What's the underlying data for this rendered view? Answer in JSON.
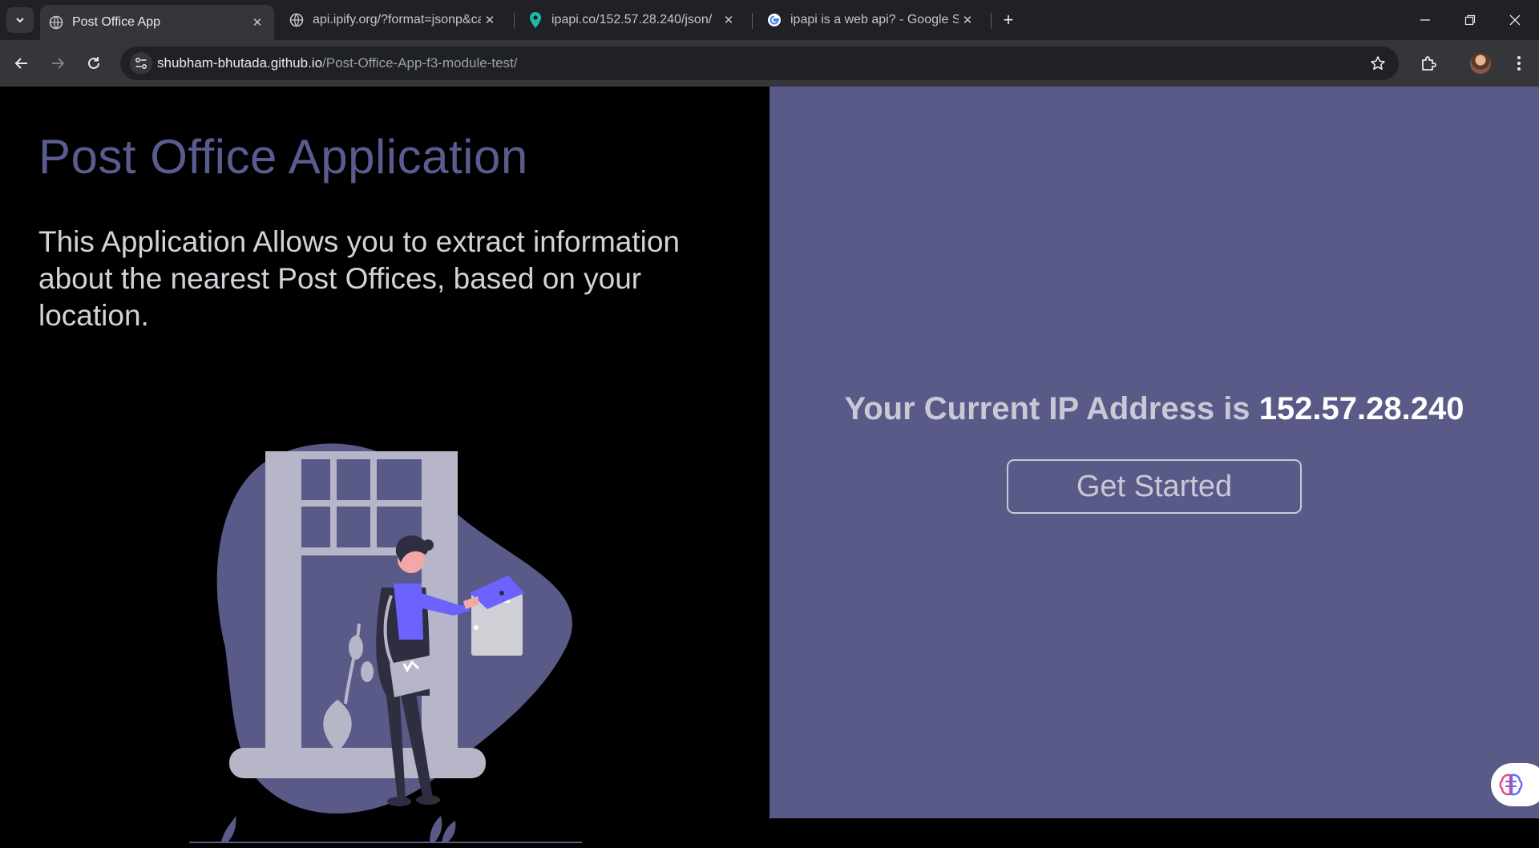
{
  "browser": {
    "tabs": [
      {
        "title": "Post Office App",
        "favicon": "globe-icon",
        "active": true
      },
      {
        "title": "api.ipify.org/?format=jsonp&ca",
        "favicon": "globe-icon",
        "active": false
      },
      {
        "title": "ipapi.co/152.57.28.240/json/",
        "favicon": "map-pin-icon",
        "active": false
      },
      {
        "title": "ipapi is a web api? - Google Sea",
        "favicon": "google-icon",
        "active": false
      }
    ],
    "url_host": "shubham-bhutada.github.io",
    "url_path": "/Post-Office-App-f3-module-test/",
    "accent_color": "#595a87"
  },
  "page": {
    "title": "Post Office Application",
    "description": "This Application Allows you to extract information about the nearest Post Offices, based on your location.",
    "ip_label": "Your Current IP Address is",
    "ip_value": "152.57.28.240",
    "cta_label": "Get Started"
  }
}
